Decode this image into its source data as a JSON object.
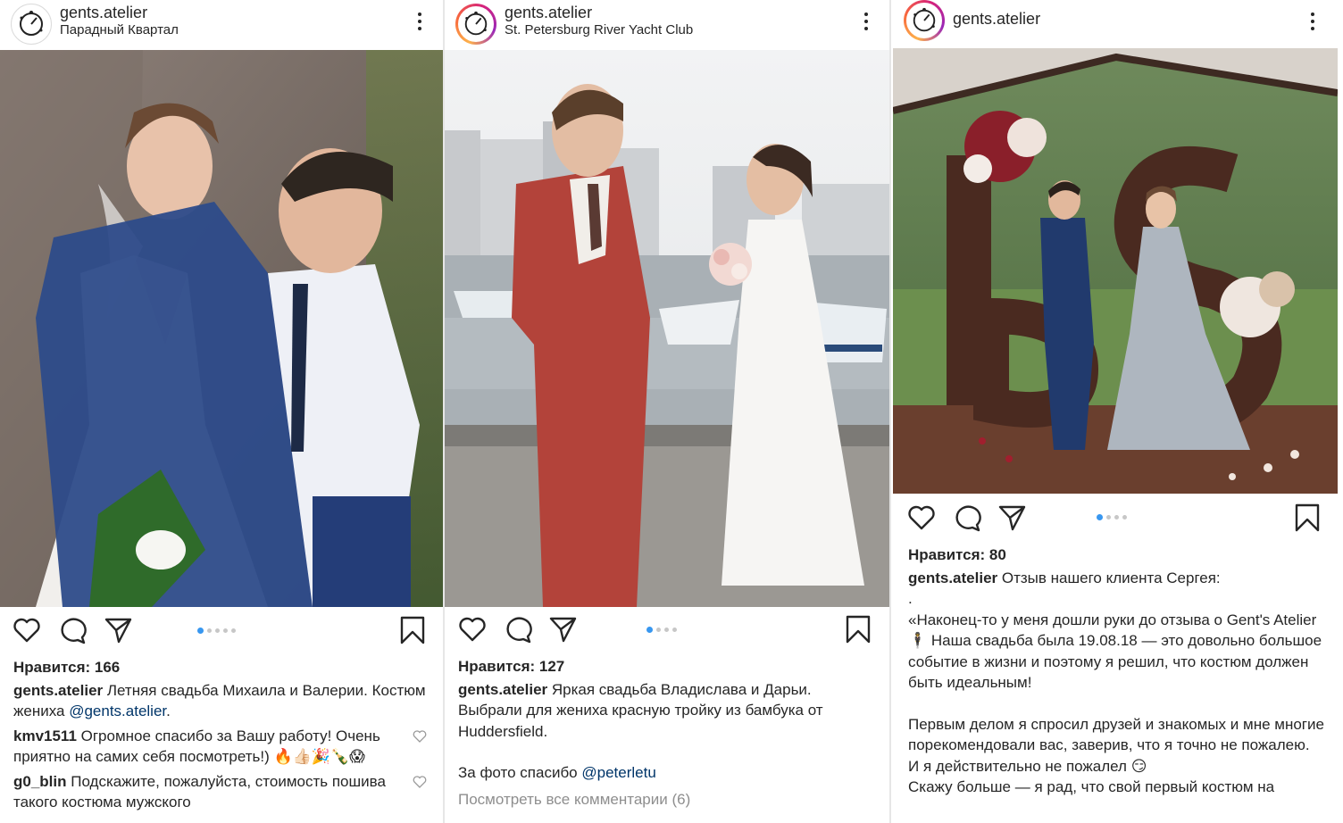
{
  "posts": [
    {
      "username": "gents.atelier",
      "location": "Парадный Квартал",
      "likes": "Нравится: 166",
      "caption_user": "gents.atelier",
      "caption_text": " Летняя свадьба Михаила и Валерии. Костюм жениха ",
      "caption_mention": "@gents.atelier",
      "caption_end": ".",
      "comments": [
        {
          "user": "kmv1511",
          "text": " Огромное спасибо за Вашу работу! Очень приятно на самих себя посмотреть!) 🔥👍🏻🎉🍾😱"
        },
        {
          "user": "g0_blin",
          "text": " Подскажите, пожалуйста, стоимость пошива такого костюма мужского"
        }
      ],
      "icons": [
        "like-icon",
        "comment-icon",
        "share-icon",
        "bookmark-icon",
        "more-icon"
      ]
    },
    {
      "username": "gents.atelier",
      "location": "St. Petersburg River Yacht Club",
      "likes": "Нравится: 127",
      "caption_user": "gents.atelier",
      "caption_text": " Яркая свадьба Владислава и Дарьи. Выбрали для жениха красную тройку из бамбука от Huddersfield.",
      "credit_text": "За фото спасибо ",
      "credit_mention": "@peterletu",
      "view_comments": "Посмотреть все комментарии (6)"
    },
    {
      "username": "gents.atelier",
      "likes": "Нравится: 80",
      "caption_user": "gents.atelier",
      "caption_text": " Отзыв нашего клиента Сергея:",
      "dot_line": ".",
      "p1": "«Наконец-то у меня дошли руки до отзыва о Gent's Atelier 🕴 Наша свадьба была 19.08.18 — это довольно большое событие в жизни и поэтому я решил, что костюм должен быть идеальным!",
      "p2": "Первым делом я спросил друзей и знакомых и мне многие порекомендовали вас, заверив, что я точно не пожалею.",
      "p3": "И я действительно не пожалел 😏",
      "p4": "Скажу больше — я рад, что свой первый костюм на"
    }
  ],
  "colors": {
    "accent_dot": "#3897f0",
    "text": "#262626",
    "muted": "#8e8e8e",
    "mention": "#003569"
  }
}
